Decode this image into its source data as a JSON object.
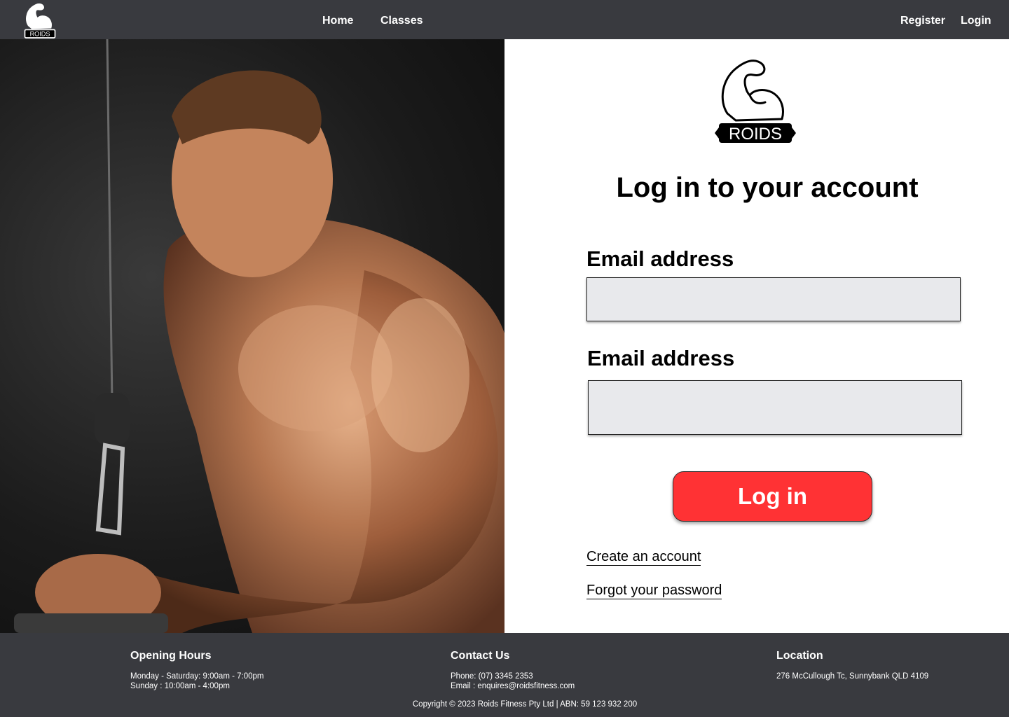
{
  "nav": {
    "logo_text": "ROIDS",
    "links": {
      "home": "Home",
      "classes": "Classes",
      "register": "Register",
      "login": "Login"
    }
  },
  "form": {
    "logo_text": "ROIDS",
    "title": "Log in to your account",
    "field1_label": "Email address",
    "field1_value": "",
    "field2_label": "Email address",
    "field2_value": "",
    "login_button": "Log in",
    "create_link": "Create an account",
    "forgot_link": "Forgot your password"
  },
  "footer": {
    "hours_heading": "Opening Hours",
    "hours_weekday": "Monday - Saturday: 9:00am - 7:00pm",
    "hours_sunday": "Sunday : 10:00am - 4:00pm",
    "contact_heading": "Contact Us",
    "phone": "Phone: (07) 3345 2353",
    "email": "Email : enquires@roidsfitness.com",
    "location_heading": "Location",
    "address": "276 McCullough Tc, Sunnybank QLD 4109",
    "copyright": "Copyright © 2023 Roids Fitness Pty Ltd | ABN: 59 123 932 200"
  },
  "colors": {
    "nav_bg": "#393a3f",
    "footer_bg": "#393a3f",
    "button_bg": "#ff3234",
    "input_bg": "#e8e9ec"
  },
  "icons": [
    "flexed-bicep-logo-icon",
    "hero-athlete-photo"
  ]
}
